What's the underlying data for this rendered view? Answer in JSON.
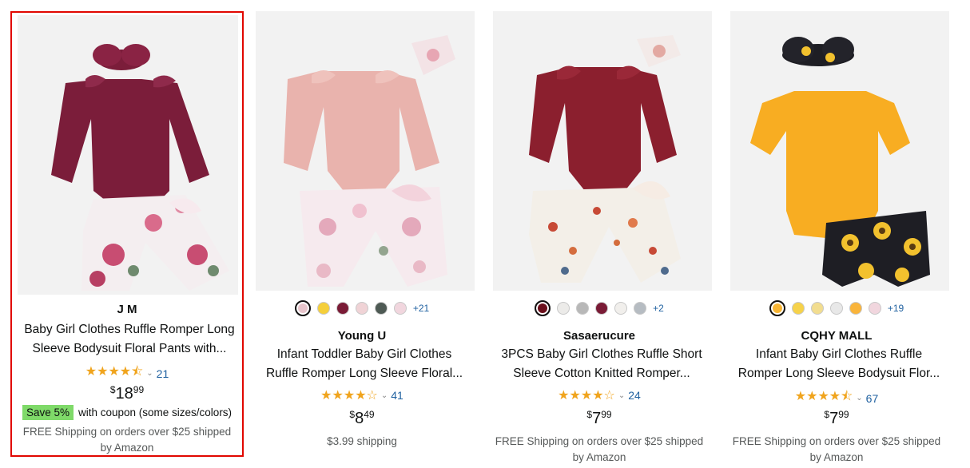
{
  "products": [
    {
      "brand": "J  M",
      "title_line1": "Baby Girl Clothes Ruffle Romper Long",
      "title_line2": "Sleeve Bodysuit Floral Pants with...",
      "stars": "★★★★⯪",
      "review_count": "21",
      "price_symbol": "$",
      "price_whole": "18",
      "price_cents": "99",
      "coupon_badge": "Save 5%",
      "coupon_text": "with coupon (some sizes/colors)",
      "shipping_line1": "FREE Shipping on orders over $25 shipped",
      "shipping_line2": "by Amazon",
      "selected": true
    },
    {
      "brand": "Young U",
      "title_line1": "Infant Toddler Baby Girl Clothes",
      "title_line2": "Ruffle Romper Long Sleeve Floral...",
      "stars": "★★★★☆",
      "review_count": "41",
      "price_symbol": "$",
      "price_whole": "8",
      "price_cents": "49",
      "shipping_line1": "$3.99 shipping",
      "swatch_colors": [
        "#e8c5cc",
        "#f5cf3a",
        "#7a1b36",
        "#f0d3d6",
        "#4e5a54",
        "#f1d6de"
      ],
      "more_colors": "+21"
    },
    {
      "brand": "Sasaerucure",
      "title_line1": "3PCS Baby Girl Clothes Ruffle Short",
      "title_line2": "Sleeve Cotton Knitted Romper...",
      "stars": "★★★★☆",
      "review_count": "24",
      "price_symbol": "$",
      "price_whole": "7",
      "price_cents": "99",
      "shipping_line1": "FREE Shipping on orders over $25 shipped",
      "shipping_line2": "by Amazon",
      "swatch_colors": [
        "#6b0f1c",
        "#ecebe9",
        "#b8b8b8",
        "#7a1b36",
        "#f1efec",
        "#b6bcc2"
      ],
      "more_colors": "+2"
    },
    {
      "brand": "CQHY MALL",
      "title_line1": "Infant Baby Girl Clothes Ruffle",
      "title_line2": "Romper Long Sleeve Bodysuit Flor...",
      "stars": "★★★★⯪",
      "review_count": "67",
      "price_symbol": "$",
      "price_whole": "7",
      "price_cents": "99",
      "shipping_line1": "FREE Shipping on orders over $25 shipped",
      "shipping_line2": "by Amazon",
      "swatch_colors": [
        "#f7b533",
        "#f6d24a",
        "#f2dd8f",
        "#e8e8e8",
        "#f9b43b",
        "#f1d6de"
      ],
      "more_colors": "+19"
    }
  ],
  "colors": {
    "selected_border": "#e10600",
    "star": "#f0a41d",
    "link": "#2162a1",
    "coupon_badge": "#7fda69"
  }
}
